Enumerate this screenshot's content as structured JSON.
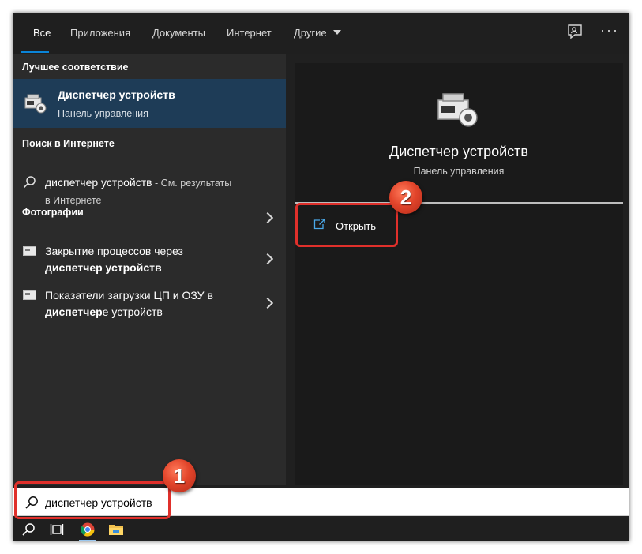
{
  "tabs": [
    {
      "label": "Все",
      "active": true
    },
    {
      "label": "Приложения"
    },
    {
      "label": "Документы"
    },
    {
      "label": "Интернет"
    },
    {
      "label": "Другие"
    }
  ],
  "sections": {
    "best_match": "Лучшее соответствие",
    "web_search": "Поиск в Интернете",
    "photos": "Фотографии"
  },
  "best_match_item": {
    "title": "Диспетчер устройств",
    "subtitle": "Панель управления",
    "icon": "device-manager-icon"
  },
  "web_result": {
    "query": "диспетчер устройств",
    "suffix": " - См. результаты",
    "suffix_line2": "в Интернете"
  },
  "photo_results": [
    {
      "line1": "Закрытие процессов через",
      "line2_bold": "диспетчер устройств",
      "line2_rest": ""
    },
    {
      "line1": "Показатели загрузки ЦП и ОЗУ в",
      "line2_bold": "диспетчер",
      "line2_rest": "е устройств"
    }
  ],
  "preview": {
    "title": "Диспетчер устройств",
    "subtitle": "Панель управления",
    "open_label": "Открыть"
  },
  "search": {
    "value": "диспетчер устройств"
  },
  "badges": {
    "one": "1",
    "two": "2"
  },
  "colors": {
    "accent": "#0a84d8",
    "selected": "#1e3c57",
    "highlight": "#e0302b"
  }
}
